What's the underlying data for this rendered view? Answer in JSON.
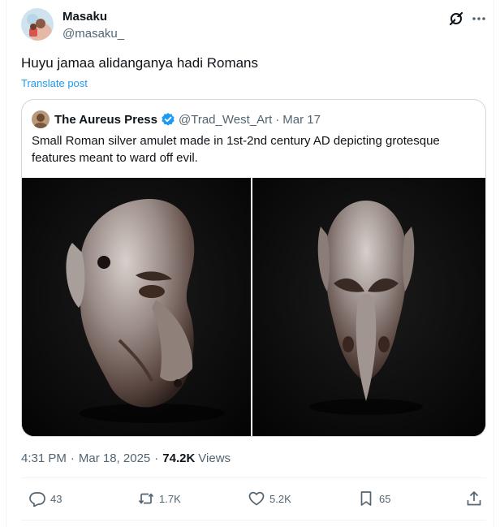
{
  "author": {
    "name": "Masaku",
    "handle": "@masaku_",
    "avatar_icon": "user-avatar"
  },
  "header_icons": [
    "grok-icon",
    "more-icon"
  ],
  "tweet": {
    "text": "Huyu jamaa alidanganya hadi Romans",
    "translate_label": "Translate post"
  },
  "quote": {
    "name": "The Aureus Press",
    "verified_icon": "verified-badge-icon",
    "handle": "@Trad_West_Art",
    "separator": "·",
    "date": "Mar 17",
    "text": "Small Roman silver amulet made in 1st-2nd century AD depicting grotesque features meant to ward off evil.",
    "images": [
      {
        "name": "amulet-side-view"
      },
      {
        "name": "amulet-front-view"
      }
    ]
  },
  "meta": {
    "time": "4:31 PM",
    "separator": "·",
    "date": "Mar 18, 2025",
    "views_count": "74.2K",
    "views_label": "Views"
  },
  "actions": {
    "replies": "43",
    "reposts": "1.7K",
    "likes": "5.2K",
    "bookmarks": "65"
  },
  "colors": {
    "accent": "#1d9bf0",
    "text_primary": "#0f1419",
    "text_secondary": "#536471",
    "border": "#cfd9de"
  }
}
